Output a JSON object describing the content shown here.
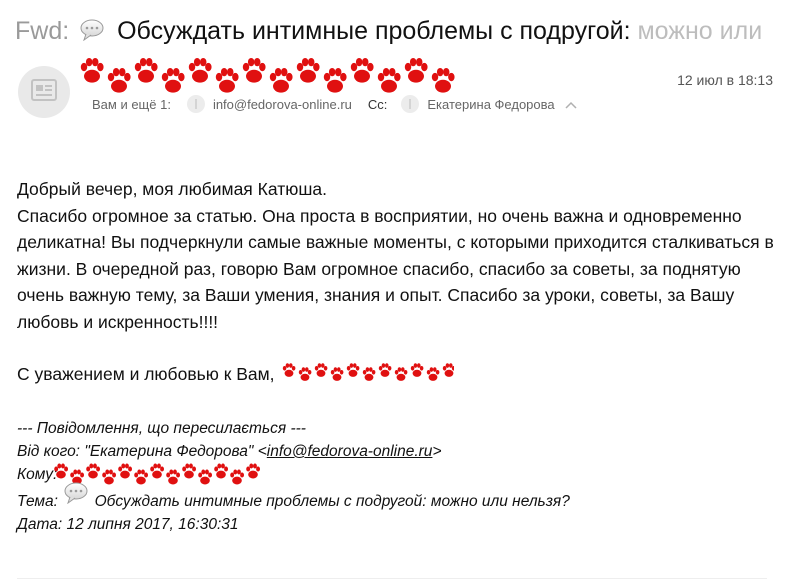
{
  "email": {
    "subject_prefix": "Fwd:",
    "subject": "Обсуждать интимные проблемы с подругой:",
    "subject_fade": "можно или",
    "date": "12 июл в 18:13",
    "recipients": {
      "to_label": "Вам и ещё 1:",
      "address": "info@fedorova-online.ru",
      "cc_label": "Cc:",
      "cc_name": "Екатерина Федорова"
    },
    "body": {
      "greeting": "Добрый вечер, моя любимая Катюша.",
      "paragraph": "Спасибо огромное за статью. Она проста в восприятии, но очень важна и одновременно деликатна! Вы подчеркнули самые важные моменты, с которыми приходится сталкиваться в жизни. В очередной раз, говорю Вам огромное спасибо, спасибо за советы, за поднятую очень важную тему, за Ваши умения, знания и опыт. Спасибо за уроки, советы, за Вашу любовь и искренность!!!!",
      "signoff": "С уважением и любовью к Вам,"
    },
    "forwarded": {
      "header": "--- Повідомлення, що пересилається ---",
      "from_label": "Від кого:",
      "from_name": "\"Екатерина Федорова\"",
      "from_open": "<",
      "from_email": "info@fedorova-online.ru",
      "from_close": ">",
      "to_label": "Кому:",
      "subject_label": "Тема:",
      "subject": "Обсуждать интимные проблемы с подругой: можно или нельзя?",
      "date_label": "Дата:",
      "date": "12 липня 2017, 16:30:31"
    }
  },
  "icons": {
    "subject": "speech-bubble-icon",
    "avatar": "newsletter-icon",
    "redaction": "paw-print-icon",
    "expand": "chevron-up-icon"
  },
  "colors": {
    "redaction": "#e01010",
    "muted": "#9a9a9a"
  }
}
